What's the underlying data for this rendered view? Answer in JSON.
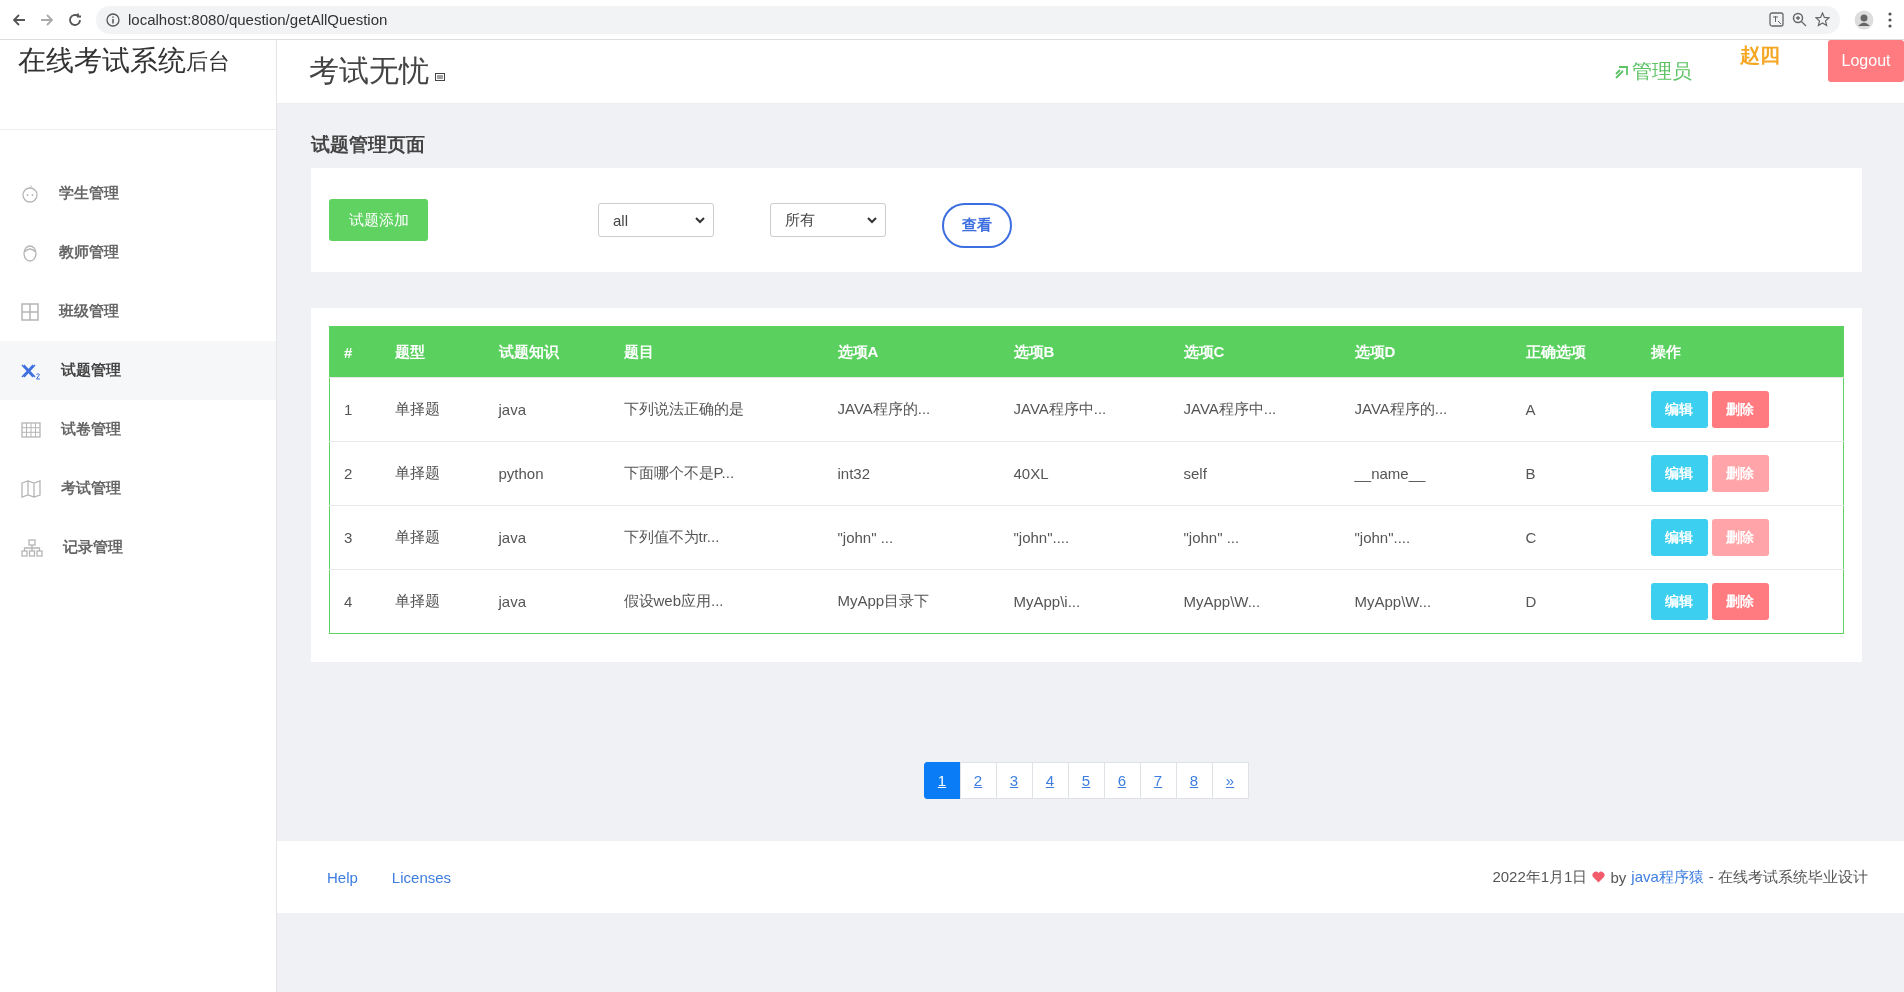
{
  "browser": {
    "url": "localhost:8080/question/getAllQuestion"
  },
  "sidebar": {
    "logo": "在线考试系统",
    "logo_suffix": "后台",
    "items": [
      {
        "label": "学生管理",
        "kind": "student",
        "selected": false
      },
      {
        "label": "教师管理",
        "kind": "teacher",
        "selected": false
      },
      {
        "label": "班级管理",
        "kind": "class",
        "selected": false
      },
      {
        "label": "试题管理",
        "kind": "question",
        "selected": true
      },
      {
        "label": "试卷管理",
        "kind": "paper",
        "selected": false
      },
      {
        "label": "考试管理",
        "kind": "exam",
        "selected": false
      },
      {
        "label": "记录管理",
        "kind": "record",
        "selected": false
      }
    ]
  },
  "header": {
    "title": "考试无忧",
    "role": "管理员",
    "user": "赵四",
    "logout": "Logout"
  },
  "page_title": "试题管理页面",
  "filters": {
    "add_button": "试题添加",
    "select_1": "all",
    "select_2": "所有",
    "view_button": "查看"
  },
  "table": {
    "columns": [
      "#",
      "题型",
      "试题知识",
      "题目",
      "选项A",
      "选项B",
      "选项C",
      "选项D",
      "正确选项",
      "操作"
    ],
    "rows": [
      {
        "cells": [
          "1",
          "单择题",
          "java",
          "下列说法正确的是",
          "JAVA程序的...",
          "JAVA程序中...",
          "JAVA程序中...",
          "JAVA程序的...",
          "A"
        ],
        "edit": "编辑",
        "delete": "删除",
        "delete_disabled": false
      },
      {
        "cells": [
          "2",
          "单择题",
          "python",
          "下面哪个不是P...",
          "int32",
          "40XL",
          "self",
          "__name__",
          "B"
        ],
        "edit": "编辑",
        "delete": "删除",
        "delete_disabled": true
      },
      {
        "cells": [
          "3",
          "单择题",
          "java",
          "下列值不为tr...",
          "\"john\" ...",
          "\"john\"....",
          "\"john\" ...",
          "\"john\"....",
          "C"
        ],
        "edit": "编辑",
        "delete": "删除",
        "delete_disabled": true
      },
      {
        "cells": [
          "4",
          "单择题",
          "java",
          "假设web应用...",
          "MyApp目录下",
          "MyApp\\i...",
          "MyApp\\W...",
          "MyApp\\W...",
          "D"
        ],
        "edit": "编辑",
        "delete": "删除",
        "delete_disabled": false
      }
    ]
  },
  "pagination": [
    {
      "label": "1",
      "selected": true
    },
    {
      "label": "2",
      "selected": false
    },
    {
      "label": "3",
      "selected": false
    },
    {
      "label": "4",
      "selected": false
    },
    {
      "label": "5",
      "selected": false
    },
    {
      "label": "6",
      "selected": false
    },
    {
      "label": "7",
      "selected": false
    },
    {
      "label": "8",
      "selected": false
    },
    {
      "label": "»",
      "selected": false
    }
  ],
  "footer": {
    "links": [
      "Help",
      "Licenses"
    ],
    "date": "2022年1月1日",
    "by": "by",
    "author": "java程序猿",
    "tail": "- 在线考试系统毕业设计"
  }
}
